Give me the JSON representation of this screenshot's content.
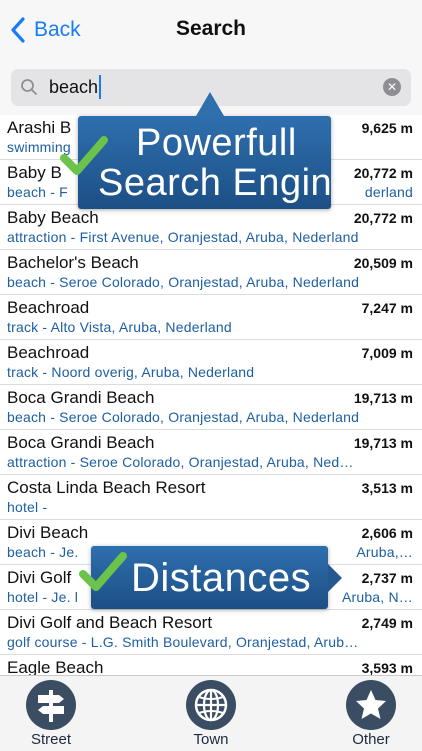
{
  "nav": {
    "back_label": "Back",
    "title": "Search"
  },
  "search": {
    "value": "beach"
  },
  "results": [
    {
      "name": "Arashi B",
      "sub": "swimming",
      "distance": "9,625 m"
    },
    {
      "name": "Baby B",
      "sub": "beach - F",
      "sub_right": "derland",
      "distance": "20,772 m"
    },
    {
      "name": "Baby Beach",
      "sub": "attraction - First Avenue, Oranjestad, Aruba, Nederland",
      "distance": "20,772 m"
    },
    {
      "name": "Bachelor's Beach",
      "sub": "beach - Seroe Colorado, Oranjestad, Aruba, Nederland",
      "distance": "20,509 m"
    },
    {
      "name": "Beachroad",
      "sub": "track - Alto Vista, Aruba, Nederland",
      "distance": "7,247 m"
    },
    {
      "name": "Beachroad",
      "sub": "track - Noord overig, Aruba, Nederland",
      "distance": "7,009 m"
    },
    {
      "name": "Boca Grandi Beach",
      "sub": "beach - Seroe Colorado, Oranjestad, Aruba, Nederland",
      "distance": "19,713 m"
    },
    {
      "name": "Boca Grandi Beach",
      "sub": "attraction - Seroe Colorado, Oranjestad, Aruba, Ned…",
      "distance": "19,713 m"
    },
    {
      "name": "Costa Linda Beach Resort",
      "sub": "hotel -",
      "distance": "3,513 m"
    },
    {
      "name": "Divi Beach",
      "sub": "beach - Je.",
      "sub_right": "Aruba,…",
      "distance": "2,606 m"
    },
    {
      "name": "Divi Golf",
      "sub": "hotel - Je. l",
      "sub_right": "Aruba, N…",
      "distance": "2,737 m"
    },
    {
      "name": "Divi Golf and Beach Resort",
      "sub": "golf course - L.G. Smith Boulevard, Oranjestad, Arub…",
      "distance": "2,749 m"
    },
    {
      "name": "Eagle Beach",
      "sub": "",
      "distance": "3,593 m"
    }
  ],
  "promos": [
    {
      "line1": "Powerfull",
      "line2": "Search Engine"
    },
    {
      "line1": "Distances"
    }
  ],
  "tabs": [
    {
      "label": "Street",
      "icon": "signpost-icon"
    },
    {
      "label": "Town",
      "icon": "globe-icon"
    },
    {
      "label": "Other",
      "icon": "star-icon"
    }
  ],
  "colors": {
    "accent": "#1a7cf4",
    "link_text": "#1d5fa3",
    "tab_icon": "#3b4d62",
    "promo_blue": "#2f6fae",
    "check_green": "#6cc24a"
  }
}
